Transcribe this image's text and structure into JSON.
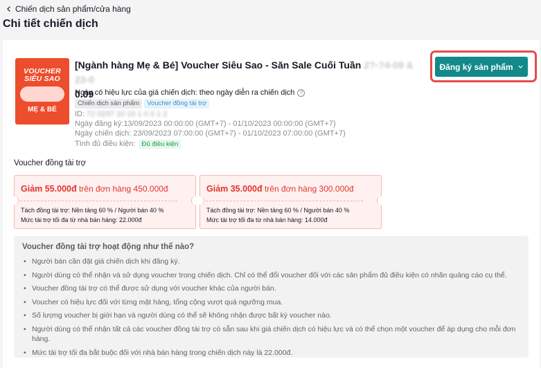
{
  "breadcrumb": {
    "label": "Chiến dịch sản phẩm/cửa hàng"
  },
  "page_title": "Chi tiết chiến dịch",
  "campaign": {
    "thumbnail": {
      "line1": "VOUCHER",
      "line2": "SIÊU SAO",
      "line3": "MẸ & BÉ"
    },
    "title_main": "[Ngành hàng Mẹ & Bé] Voucher Siêu Sao - Săn Sale Cuối Tuần ",
    "title_blurred": "2?-?4-09 & 23-0",
    "title_line2": "0.09",
    "price_note": "Ngày có hiệu lực của giá chiến dịch: theo ngày diễn ra chiến dịch",
    "tags": [
      "Chiến dịch sản phẩm",
      "Voucher đồng tài trợ"
    ],
    "id_label": "ID: ",
    "id_value": "72 0237 10 10 1 0 0 1 2",
    "registration": "Ngày đăng ký:13/09/2023 00:00:00 (GMT+7) - 01/10/2023 00:00:00 (GMT+7)",
    "campaign_dates": "Ngày chiến dịch: 23/09/2023 07:00:00 (GMT+7) - 01/10/2023 07:00:00 (GMT+7)",
    "eligibility_label": "Tình đủ điều kiện:",
    "eligibility_badge": "Đủ điều kiện",
    "register_button": "Đăng ký sản phẩm"
  },
  "vouchers_section": {
    "label": "Voucher đồng tài trợ",
    "items": [
      {
        "discount": "Giảm 55.000đ",
        "condition": " trên đơn hàng 450.000đ",
        "split": "Tách đồng tài trợ: Nền tảng 60 % / Người bán 40 %",
        "cap": "Mức tài trợ tối đa từ nhà bán hàng: 22.000đ"
      },
      {
        "discount": "Giảm 35.000đ",
        "condition": " trên đơn hàng 300.000đ",
        "split": "Tách đồng tài trợ: Nền tảng 60 % / Người bán 40 %",
        "cap": "Mức tài trợ tối đa từ nhà bán hàng: 14.000đ"
      }
    ]
  },
  "info": {
    "title": "Voucher đồng tài trợ hoạt động như thế nào?",
    "items": [
      "Người bán cần đặt giá chiến dịch khi đăng ký.",
      "Người dùng có thể nhận và sử dụng voucher trong chiến dịch. Chỉ có thể đổi voucher đối với các sản phẩm đủ điều kiện có nhãn quảng cáo cụ thể.",
      "Voucher đồng tài trợ có thể được sử dụng với voucher khác của người bán.",
      "Voucher có hiệu lực đối với từng mặt hàng, tổng cộng vượt quá ngưỡng mua.",
      "Số lượng voucher bị giới hạn và người dùng có thể sẽ không nhận được bất kỳ voucher nào.",
      "Người dùng có thể nhận tất cả các voucher đồng tài trợ có sẵn sau khi giá chiến dịch có hiệu lực và có thể chọn một voucher để áp dụng cho mỗi đơn hàng.",
      "Mức tài trợ tối đa bắt buộc đối với nhà bán hàng trong chiến dịch này là 22.000đ."
    ]
  },
  "colors": {
    "accent": "#13898a",
    "highlight": "#e34b4b",
    "voucher_red": "#e0352b",
    "thumb_bg": "#ee4d2d"
  }
}
